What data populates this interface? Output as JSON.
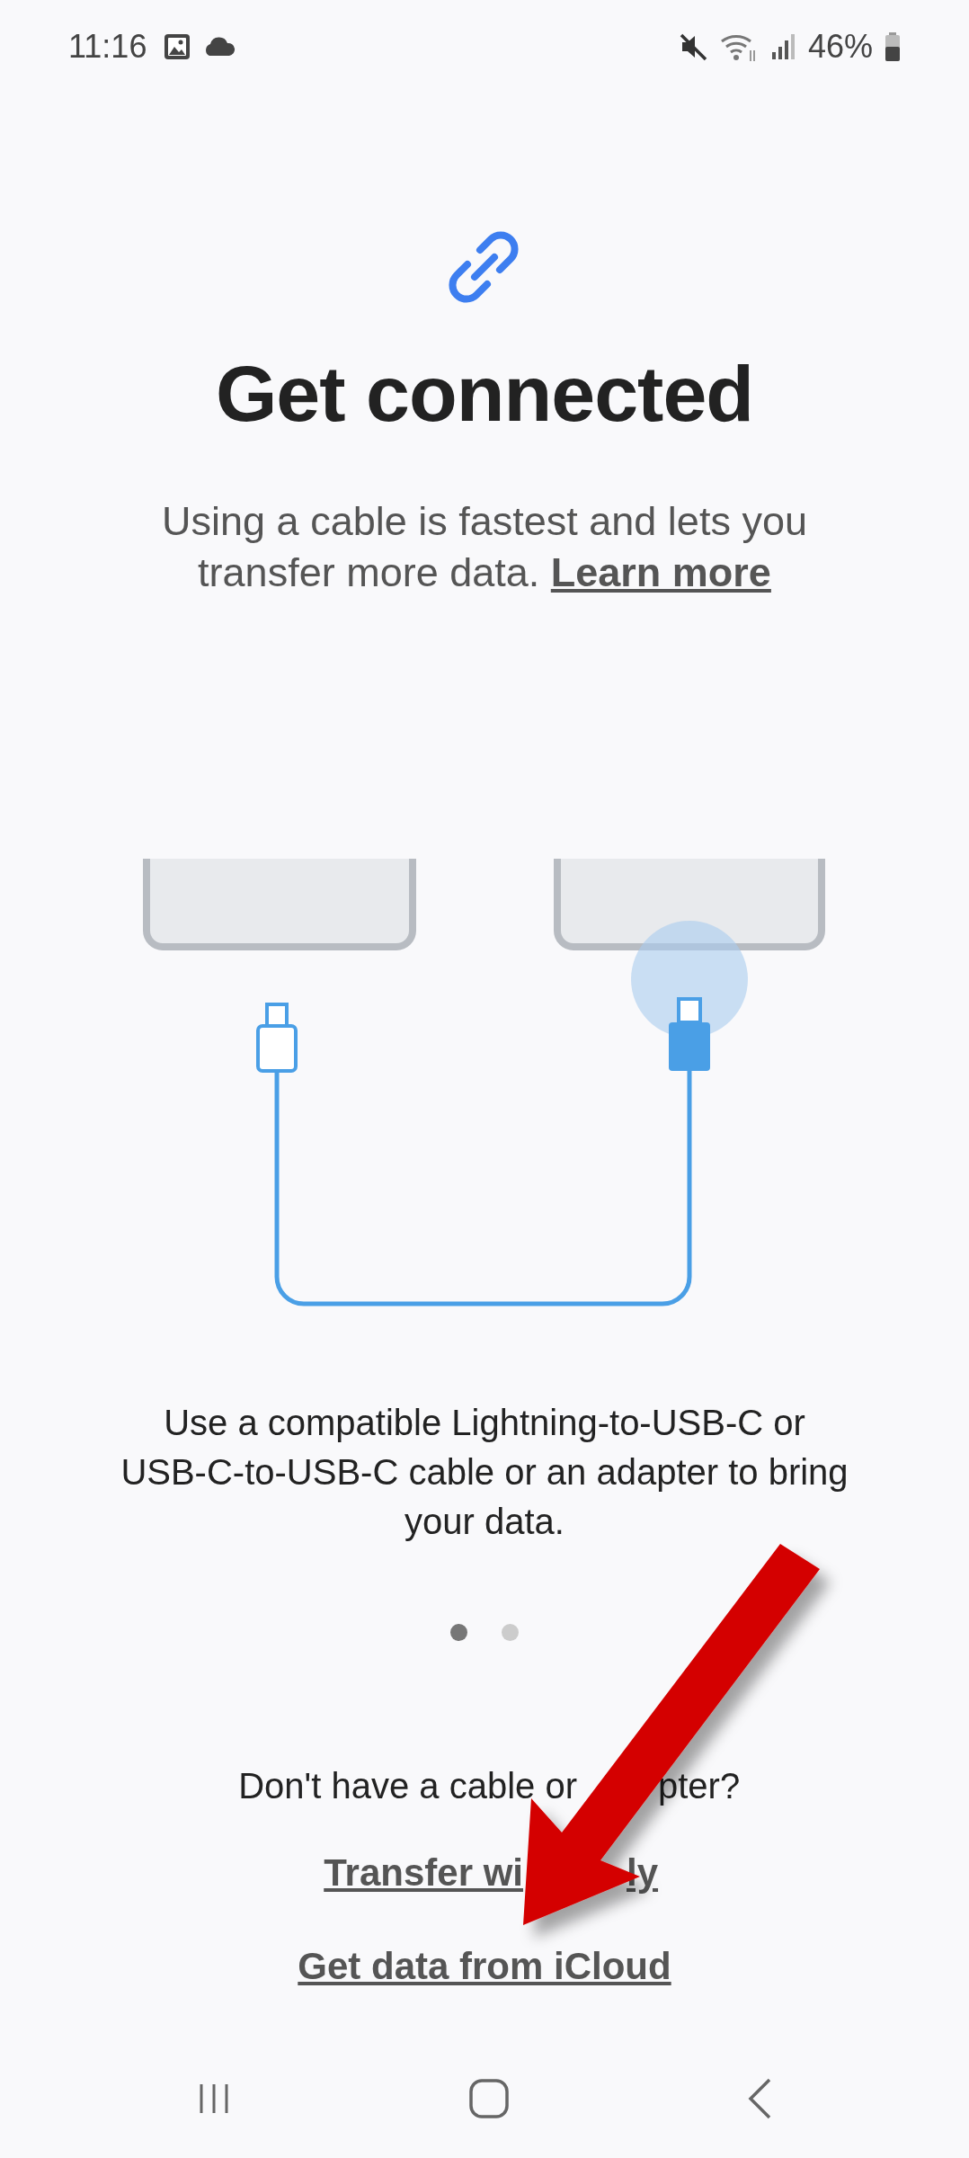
{
  "status_bar": {
    "time": "11:16",
    "battery": "46%"
  },
  "title": "Get connected",
  "subtitle": {
    "text": "Using a cable is fastest and lets you transfer more data.",
    "link": "Learn more"
  },
  "caption": "Use a compatible Lightning-to-USB-C or USB-C-to-USB-C cable or an adapter to bring your data.",
  "pager": [
    {
      "selected": true
    },
    {
      "selected": false
    }
  ],
  "question": {
    "parts": [
      "Don't have a cable or",
      "pter?"
    ]
  },
  "links": [
    {
      "parts": [
        "Transfer wi",
        "ly"
      ]
    },
    {
      "parts": [
        "Get data from iCloud"
      ]
    }
  ]
}
